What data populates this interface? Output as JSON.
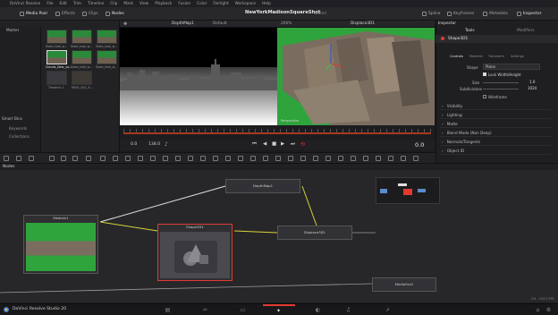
{
  "menubar": {
    "items": [
      "DaVinci Resolve",
      "File",
      "Edit",
      "Trim",
      "Timeline",
      "Clip",
      "Mark",
      "View",
      "Playback",
      "Fusion",
      "Color",
      "Fairlight",
      "Workspace",
      "Help"
    ]
  },
  "toolbar": {
    "media_pool": "Media Pool",
    "effects": "Effects",
    "clips": "Clips",
    "nodes": "Nodes",
    "project_title": "NewYorkMadisonSquareShot",
    "edited": "Edited",
    "spline": "Spline",
    "keyframes": "Keyframes",
    "metadata": "Metadata",
    "inspector": "Inspector"
  },
  "media_pool": {
    "master_label": "Master",
    "smart_bins_label": "Smart Bins",
    "smart_items": [
      "Keywords",
      "Collections"
    ],
    "clips": [
      {
        "name": "Slate_test_w..."
      },
      {
        "name": "Slate_test_w..."
      },
      {
        "name": "Slate_test_w..."
      },
      {
        "name": "Clouds_New_yo..."
      },
      {
        "name": "Slate_test_w..."
      },
      {
        "name": "Slate_test_w..."
      },
      {
        "name": "Timeline 1"
      },
      {
        "name": "MVIX_001_9..."
      }
    ]
  },
  "viewer": {
    "left_name": "DepthMap1",
    "right_name": "Displace3D1",
    "default_label": "Default",
    "zoom": "206%",
    "perspective": "Perspective",
    "in_frame": "0.0",
    "out_frame": "138.0",
    "current_frame": "0.0"
  },
  "inspector": {
    "title": "Inspector",
    "tabs": [
      "Tools",
      "Modifiers"
    ],
    "node_name": "Shape3D1",
    "sub_tabs": [
      "Controls",
      "Material",
      "Transform",
      "Settings"
    ],
    "shape_label": "Shape",
    "shape_value": "Plane",
    "lock_label": "Lock Width/Height",
    "size_label": "Size",
    "size_value": "1.0",
    "subdivisions_label": "Subdivisions",
    "subdivisions_value": "1024",
    "wireframe_label": "Wireframe",
    "sections": [
      "Visibility",
      "Lighting",
      "Matte",
      "Blend Mode (Non Deep)",
      "Normals/Tangents",
      "Object ID"
    ]
  },
  "nodes": {
    "header": "Nodes",
    "items": [
      {
        "id": "mediain1",
        "label": "MediaIn1"
      },
      {
        "id": "depthmap1",
        "label": "DepthMap1"
      },
      {
        "id": "shape3d1",
        "label": "Shape3D1"
      },
      {
        "id": "displace3d1",
        "label": "Displace3D1"
      },
      {
        "id": "mediaout1",
        "label": "MediaOut1"
      }
    ],
    "zoom_readout": "2% - 152.2 FPS"
  },
  "bottombar": {
    "app_name": "DaVinci Resolve Studio 20"
  },
  "colors": {
    "green_screen": "#2fa43c",
    "selected_red": "#e23a32",
    "link_yellow": "#d9d23a",
    "link_white": "#e0e0e0"
  }
}
